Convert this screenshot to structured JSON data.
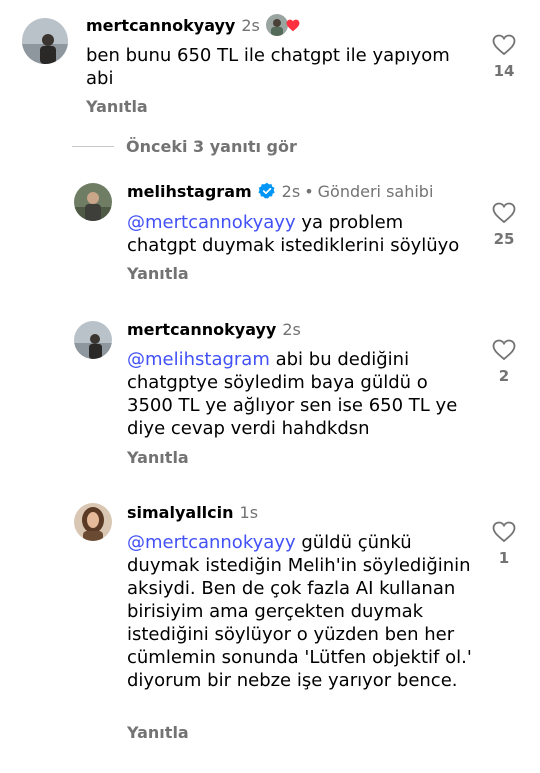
{
  "comments": [
    {
      "username": "mertcannokyayy",
      "time": "2s",
      "text": "ben bunu 650 TL ile chatgpt ile yapıyom abi",
      "reply": "Yanıtla",
      "likes": "14"
    },
    {
      "username": "melihstagram",
      "time": "2s",
      "owner_label": "Gönderi sahibi",
      "mention": "@mertcannokyayy",
      "text": " ya problem chatgpt duymak istediklerini söylüyo",
      "reply": "Yanıtla",
      "likes": "25"
    },
    {
      "username": "mertcannokyayy",
      "time": "2s",
      "mention": "@melihstagram",
      "text": " abi bu dediğini chatgptye söyledim baya güldü o 3500 TL ye ağlıyor sen ise 650 TL ye diye cevap verdi hahdkdsn",
      "reply": "Yanıtla",
      "likes": "2"
    },
    {
      "username": "simalyallcin",
      "time": "1s",
      "mention": "@mertcannokyayy",
      "text": " güldü çünkü duymak istediğin Melih'in söylediğinin aksiydi. Ben de çok fazla AI kullanan birisiyim ama gerçekten duymak istediğini söylüyor o yüzden ben her cümlemin sonunda 'Lütfen objektif ol.' diyorum bir nebze işe yarıyor bence.",
      "reply": "Yanıtla",
      "likes": "1"
    }
  ],
  "view_more": "Önceki 3 yanıtı gör",
  "icons": {
    "like": "heart-outline-icon",
    "verified": "verified-badge-icon",
    "liked_by_author": "author-liked-heart-icon"
  },
  "colors": {
    "mention": "#4150f7",
    "secondary_text": "#737373",
    "verified": "#0095f6",
    "author_heart": "#ff3040"
  }
}
